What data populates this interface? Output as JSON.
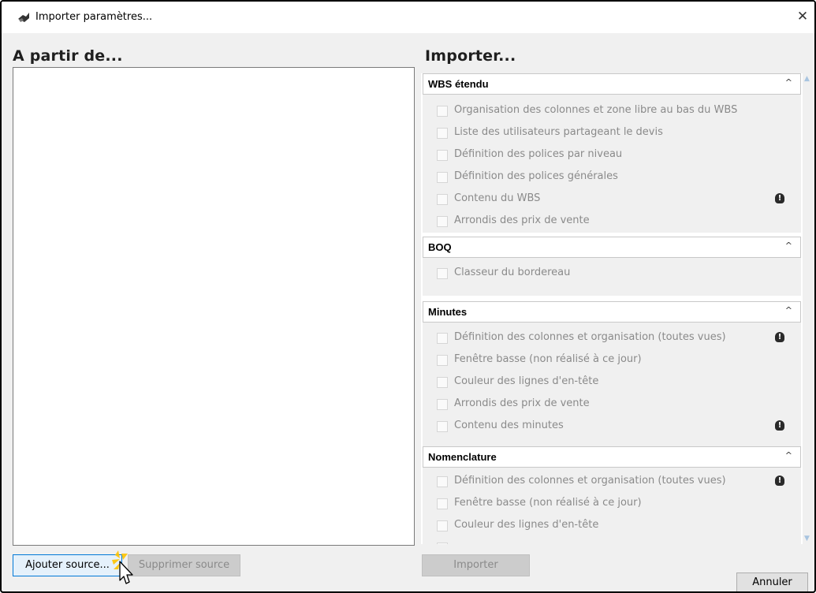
{
  "window": {
    "title": "Importer paramètres...",
    "close_glyph": "✕"
  },
  "left": {
    "heading": "A partir de..."
  },
  "right": {
    "heading": "Importer...",
    "groups": [
      {
        "title": "WBS étendu",
        "items": [
          {
            "label": "Organisation des colonnes et zone libre au bas du WBS",
            "checked": false,
            "warning": false
          },
          {
            "label": "Liste des utilisateurs partageant le devis",
            "checked": false,
            "warning": false
          },
          {
            "label": "Définition des polices par niveau",
            "checked": false,
            "warning": false
          },
          {
            "label": "Définition des polices générales",
            "checked": false,
            "warning": false
          },
          {
            "label": "Contenu du WBS",
            "checked": false,
            "warning": true
          },
          {
            "label": "Arrondis des prix de vente",
            "checked": false,
            "warning": false
          }
        ]
      },
      {
        "title": "BOQ",
        "items": [
          {
            "label": "Classeur du bordereau",
            "checked": false,
            "warning": false
          }
        ]
      },
      {
        "title": "Minutes",
        "items": [
          {
            "label": "Définition des colonnes et organisation (toutes vues)",
            "checked": false,
            "warning": true
          },
          {
            "label": "Fenêtre basse (non réalisé à ce jour)",
            "checked": false,
            "warning": false
          },
          {
            "label": "Couleur des lignes d'en-tête",
            "checked": false,
            "warning": false
          },
          {
            "label": "Arrondis des prix de vente",
            "checked": false,
            "warning": false
          },
          {
            "label": "Contenu des minutes",
            "checked": false,
            "warning": true
          }
        ]
      },
      {
        "title": "Nomenclature",
        "items": [
          {
            "label": "Définition des colonnes et organisation (toutes vues)",
            "checked": false,
            "warning": true
          },
          {
            "label": "Fenêtre basse (non réalisé à ce jour)",
            "checked": false,
            "warning": false
          },
          {
            "label": "Couleur des lignes d'en-tête",
            "checked": false,
            "warning": false
          }
        ]
      }
    ],
    "warning_glyph": "!",
    "chevron_glyph": "^"
  },
  "buttons": {
    "add_source": "Ajouter source...",
    "remove_source": "Supprimer source",
    "import": "Importer",
    "cancel": "Annuler"
  },
  "colors": {
    "accent": "#0078d7",
    "disabled_text": "#8a8a8a",
    "panel_bg": "#f0f0f0"
  }
}
